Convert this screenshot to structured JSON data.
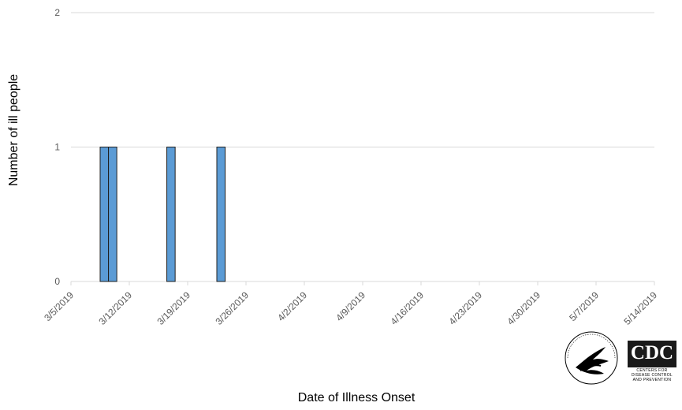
{
  "chart_data": {
    "type": "bar",
    "ylabel": "Number of ill people",
    "xlabel": "Date of Illness Onset",
    "ylim": [
      0,
      2
    ],
    "yticks": [
      0,
      1,
      2
    ],
    "xticks": [
      "3/5/2019",
      "3/12/2019",
      "3/19/2019",
      "3/26/2019",
      "4/2/2019",
      "4/9/2019",
      "4/16/2019",
      "4/23/2019",
      "4/30/2019",
      "5/7/2019",
      "5/14/2019"
    ],
    "x_range": [
      "3/5/2019",
      "5/14/2019"
    ],
    "bars": [
      {
        "date": "3/9/2019",
        "value": 1
      },
      {
        "date": "3/10/2019",
        "value": 1
      },
      {
        "date": "3/17/2019",
        "value": 1
      },
      {
        "date": "3/23/2019",
        "value": 1
      }
    ],
    "bar_color": "#5b9bd5",
    "bar_edge_color": "#1f1f1f",
    "grid": true,
    "grid_color": "#d9d9d9"
  },
  "logos": {
    "hhs_text": "DEPARTMENT OF HEALTH & HUMAN SERVICES USA",
    "cdc_text": "CDC",
    "cdc_subtext": "CENTERS FOR DISEASE CONTROL AND PREVENTION"
  }
}
